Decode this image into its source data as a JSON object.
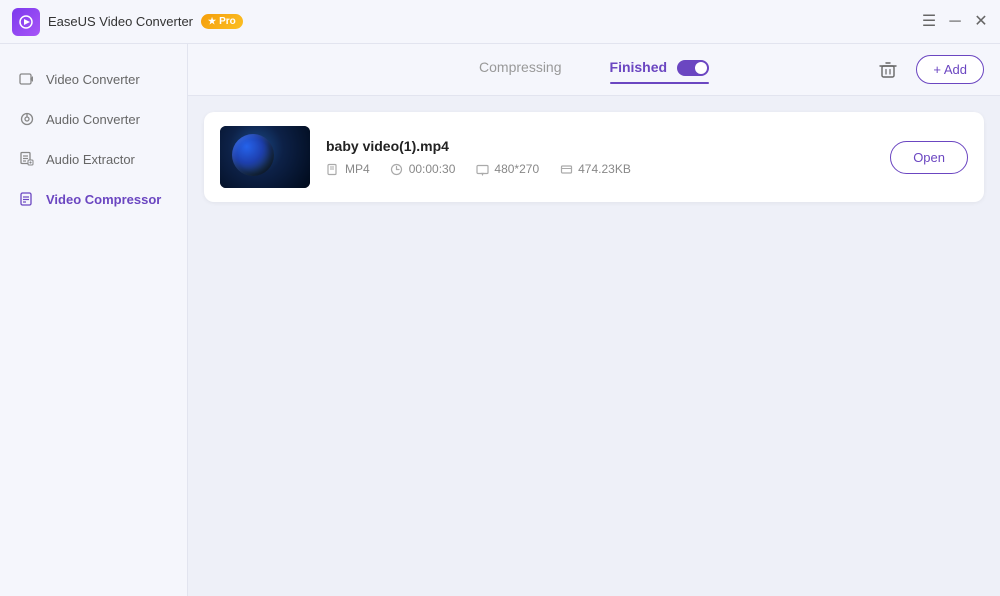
{
  "titleBar": {
    "appName": "EaseUS Video Converter",
    "proBadge": "Pro",
    "controls": {
      "menu": "☰",
      "minimize": "─",
      "close": "✕"
    }
  },
  "sidebar": {
    "items": [
      {
        "id": "video-converter",
        "label": "Video Converter",
        "active": false
      },
      {
        "id": "audio-converter",
        "label": "Audio Converter",
        "active": false
      },
      {
        "id": "audio-extractor",
        "label": "Audio Extractor",
        "active": false
      },
      {
        "id": "video-compressor",
        "label": "Video Compressor",
        "active": true
      }
    ]
  },
  "tabs": {
    "compressing": {
      "label": "Compressing"
    },
    "finished": {
      "label": "Finished"
    }
  },
  "toolbar": {
    "trashLabel": "🗑",
    "addLabel": "+ Add"
  },
  "videoList": {
    "items": [
      {
        "id": "baby-video",
        "name": "baby video(1).mp4",
        "format": "MP4",
        "duration": "00:00:30",
        "resolution": "480*270",
        "size": "474.23KB",
        "openLabel": "Open"
      }
    ]
  }
}
